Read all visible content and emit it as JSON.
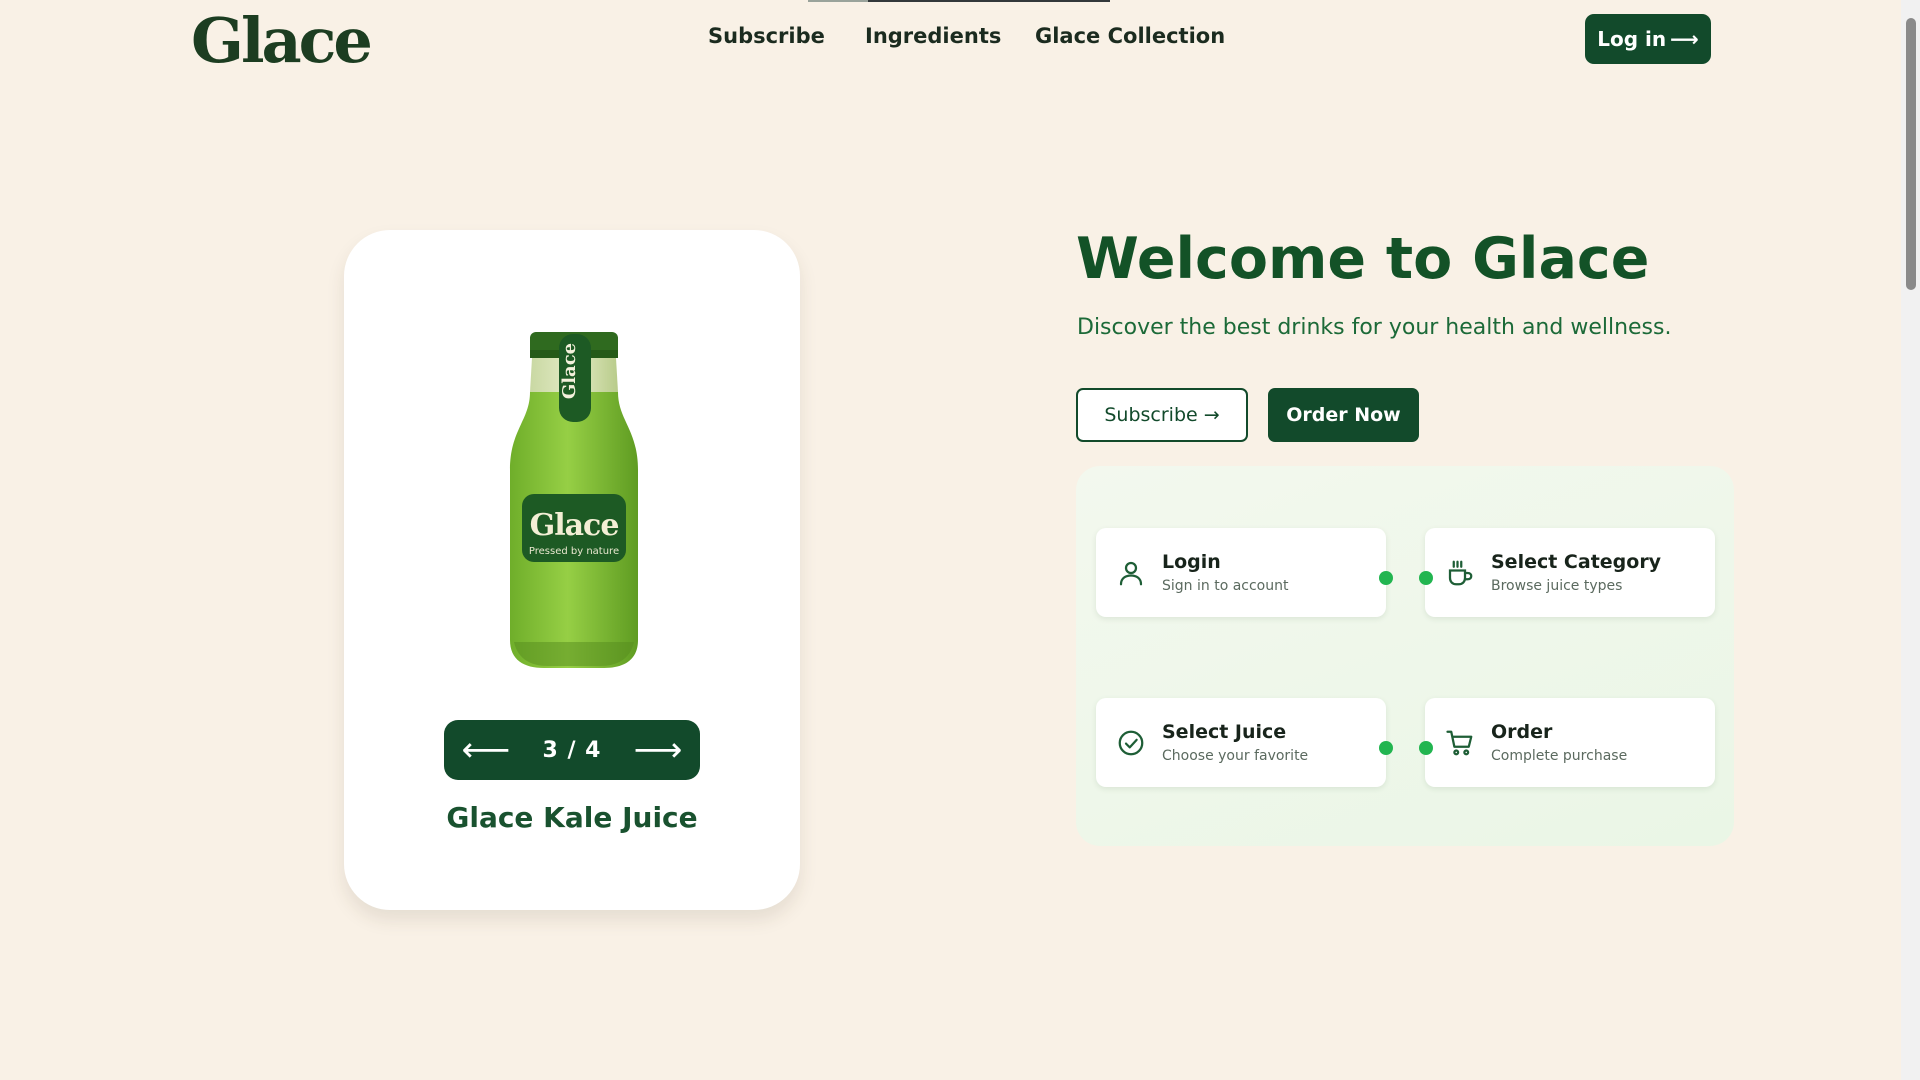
{
  "header": {
    "logo": "Glace",
    "nav": [
      {
        "label": "Subscribe"
      },
      {
        "label": "Ingredients"
      },
      {
        "label": "Glace Collection"
      }
    ],
    "login_label": "Log in",
    "login_arrow": "⟶"
  },
  "product": {
    "bottle_logo": "Glace",
    "bottle_tagline": "Pressed by nature",
    "bottle_tab": "Glace",
    "pager": {
      "prev": "⟵",
      "count": "3 / 4",
      "next": "⟶",
      "current": 3,
      "total": 4
    },
    "name": "Glace Kale Juice"
  },
  "hero": {
    "title": "Welcome to Glace",
    "subtitle": "Discover the best drinks for your health and wellness.",
    "subscribe_label": "Subscribe →",
    "order_label": "Order Now"
  },
  "steps": [
    {
      "title": "Login",
      "desc": "Sign in to account",
      "icon": "user-icon"
    },
    {
      "title": "Select Category",
      "desc": "Browse juice types",
      "icon": "cup-icon"
    },
    {
      "title": "Select Juice",
      "desc": "Choose your favorite",
      "icon": "check-circle-icon"
    },
    {
      "title": "Order",
      "desc": "Complete purchase",
      "icon": "cart-icon"
    }
  ],
  "colors": {
    "background": "#f9f1e6",
    "brand_dark": "#124a2b",
    "bottle_green": "#8dc63f",
    "dot_green": "#22b550"
  }
}
